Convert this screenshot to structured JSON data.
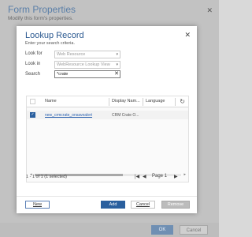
{
  "background_dialog": {
    "title": "Form Properties",
    "subtitle": "Modify this form's properties.",
    "close_glyph": "✕",
    "ok_label": "OK",
    "cancel_label": "Cancel"
  },
  "lookup": {
    "title": "Lookup Record",
    "subtitle": "Enter your search criteria.",
    "close_glyph": "✕",
    "look_for_label": "Look for",
    "look_for_value": "Web Resource",
    "look_in_label": "Look in",
    "look_in_value": "WebResource Lookup View",
    "search_label": "Search",
    "search_value": "*crate",
    "search_clear_glyph": "✕",
    "dropdown_glyph": "▾"
  },
  "grid": {
    "columns": [
      "Name",
      "Display Nam...",
      "Language"
    ],
    "refresh_glyph": "↻",
    "rows": [
      {
        "name": "new_crmcrate_onsavealert",
        "display_name": "CRM Crate O...",
        "selected": true,
        "check_glyph": "✓"
      }
    ],
    "scroll_left_glyph": "◂",
    "scroll_right_glyph": "▸"
  },
  "pager": {
    "info": "1 - 1 of 1 (1 selected)",
    "first_glyph": "|◀",
    "prev_glyph": "◀",
    "page_label": "Page 1",
    "next_glyph": "▶"
  },
  "buttons": {
    "new_label": "New",
    "add_label": "Add",
    "cancel_label": "Cancel",
    "remove_label": "Remove Value"
  },
  "colors": {
    "accent": "#2a5f9e",
    "title_blue": "#2c5a91",
    "link_blue": "#2d63b0"
  }
}
